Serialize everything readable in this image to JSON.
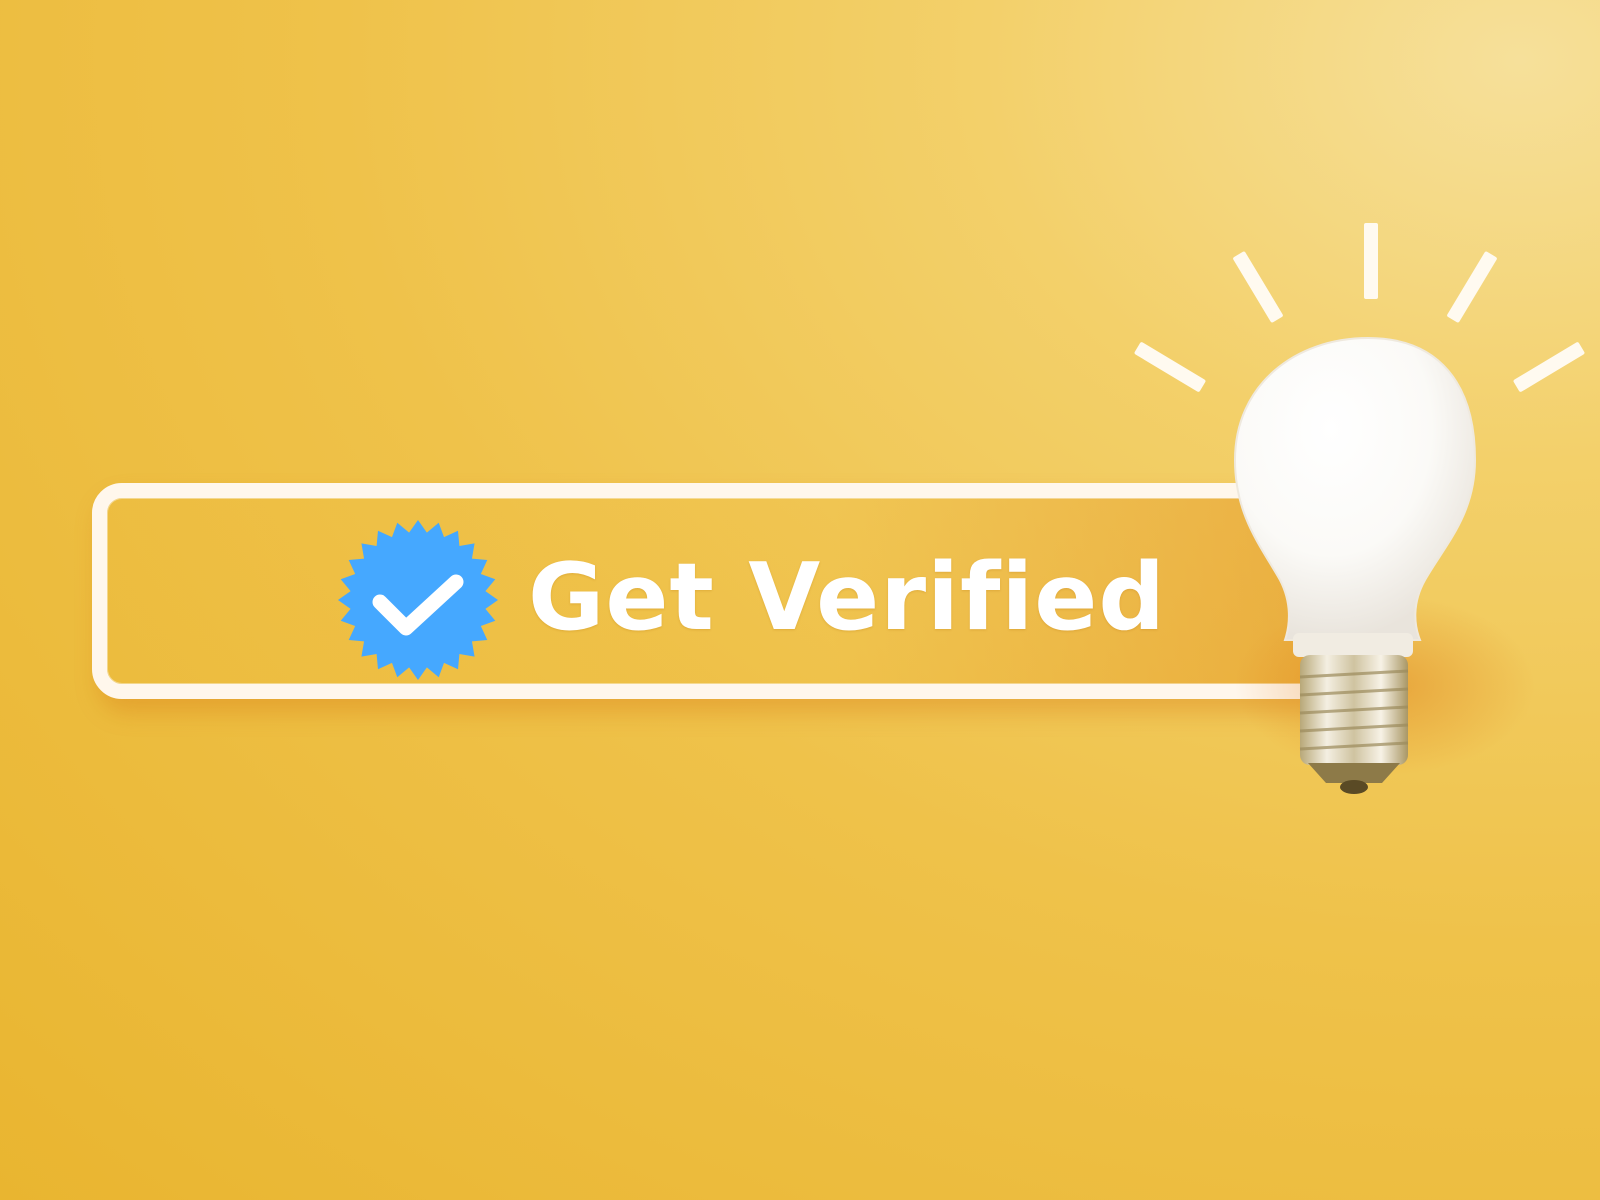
{
  "cta": {
    "label": "Get Verified",
    "badge_icon": "verified-check-badge-icon",
    "badge_color": "#45a8ff",
    "text_color": "#ffffff"
  },
  "illustration": {
    "icon": "lightbulb-icon",
    "background_color": "#efc24a",
    "frame_color": "#fff7ec"
  }
}
